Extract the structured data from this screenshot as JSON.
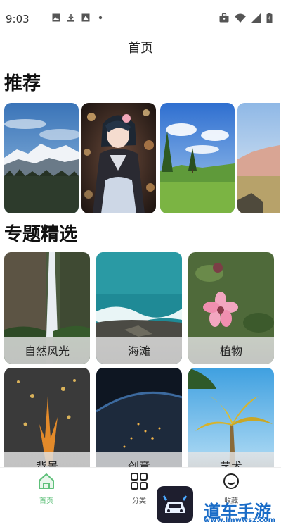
{
  "status_bar": {
    "time": "9:03",
    "left_icons": [
      "image-icon",
      "download-icon",
      "photo-icon",
      "dot-icon"
    ],
    "right_icons": [
      "briefcase-icon",
      "wifi-icon",
      "signal-icon",
      "battery-icon"
    ]
  },
  "header": {
    "title": "首页"
  },
  "sections": {
    "recommend": {
      "title": "推荐"
    },
    "topics": {
      "title": "专题精选"
    }
  },
  "recommended_images": [
    {
      "name": "snowy-mountain-wallpaper"
    },
    {
      "name": "anime-girl-wallpaper"
    },
    {
      "name": "green-meadow-wallpaper"
    },
    {
      "name": "desert-landscape-wallpaper"
    }
  ],
  "topics": [
    {
      "label": "自然风光"
    },
    {
      "label": "海滩"
    },
    {
      "label": "植物"
    },
    {
      "label": "背景"
    },
    {
      "label": "创意"
    },
    {
      "label": "艺术"
    }
  ],
  "bottom_nav": {
    "items": [
      {
        "label": "首页",
        "icon": "home-icon",
        "active": true,
        "active_color": "#5fc07a"
      },
      {
        "label": "分类",
        "icon": "grid-icon",
        "active": false
      },
      {
        "label": "收藏",
        "icon": "favorite-icon",
        "active": false
      }
    ]
  },
  "watermark": {
    "text": "道车手游网",
    "url": "www.lmwwsz.com",
    "color": "#1a6cc7"
  }
}
